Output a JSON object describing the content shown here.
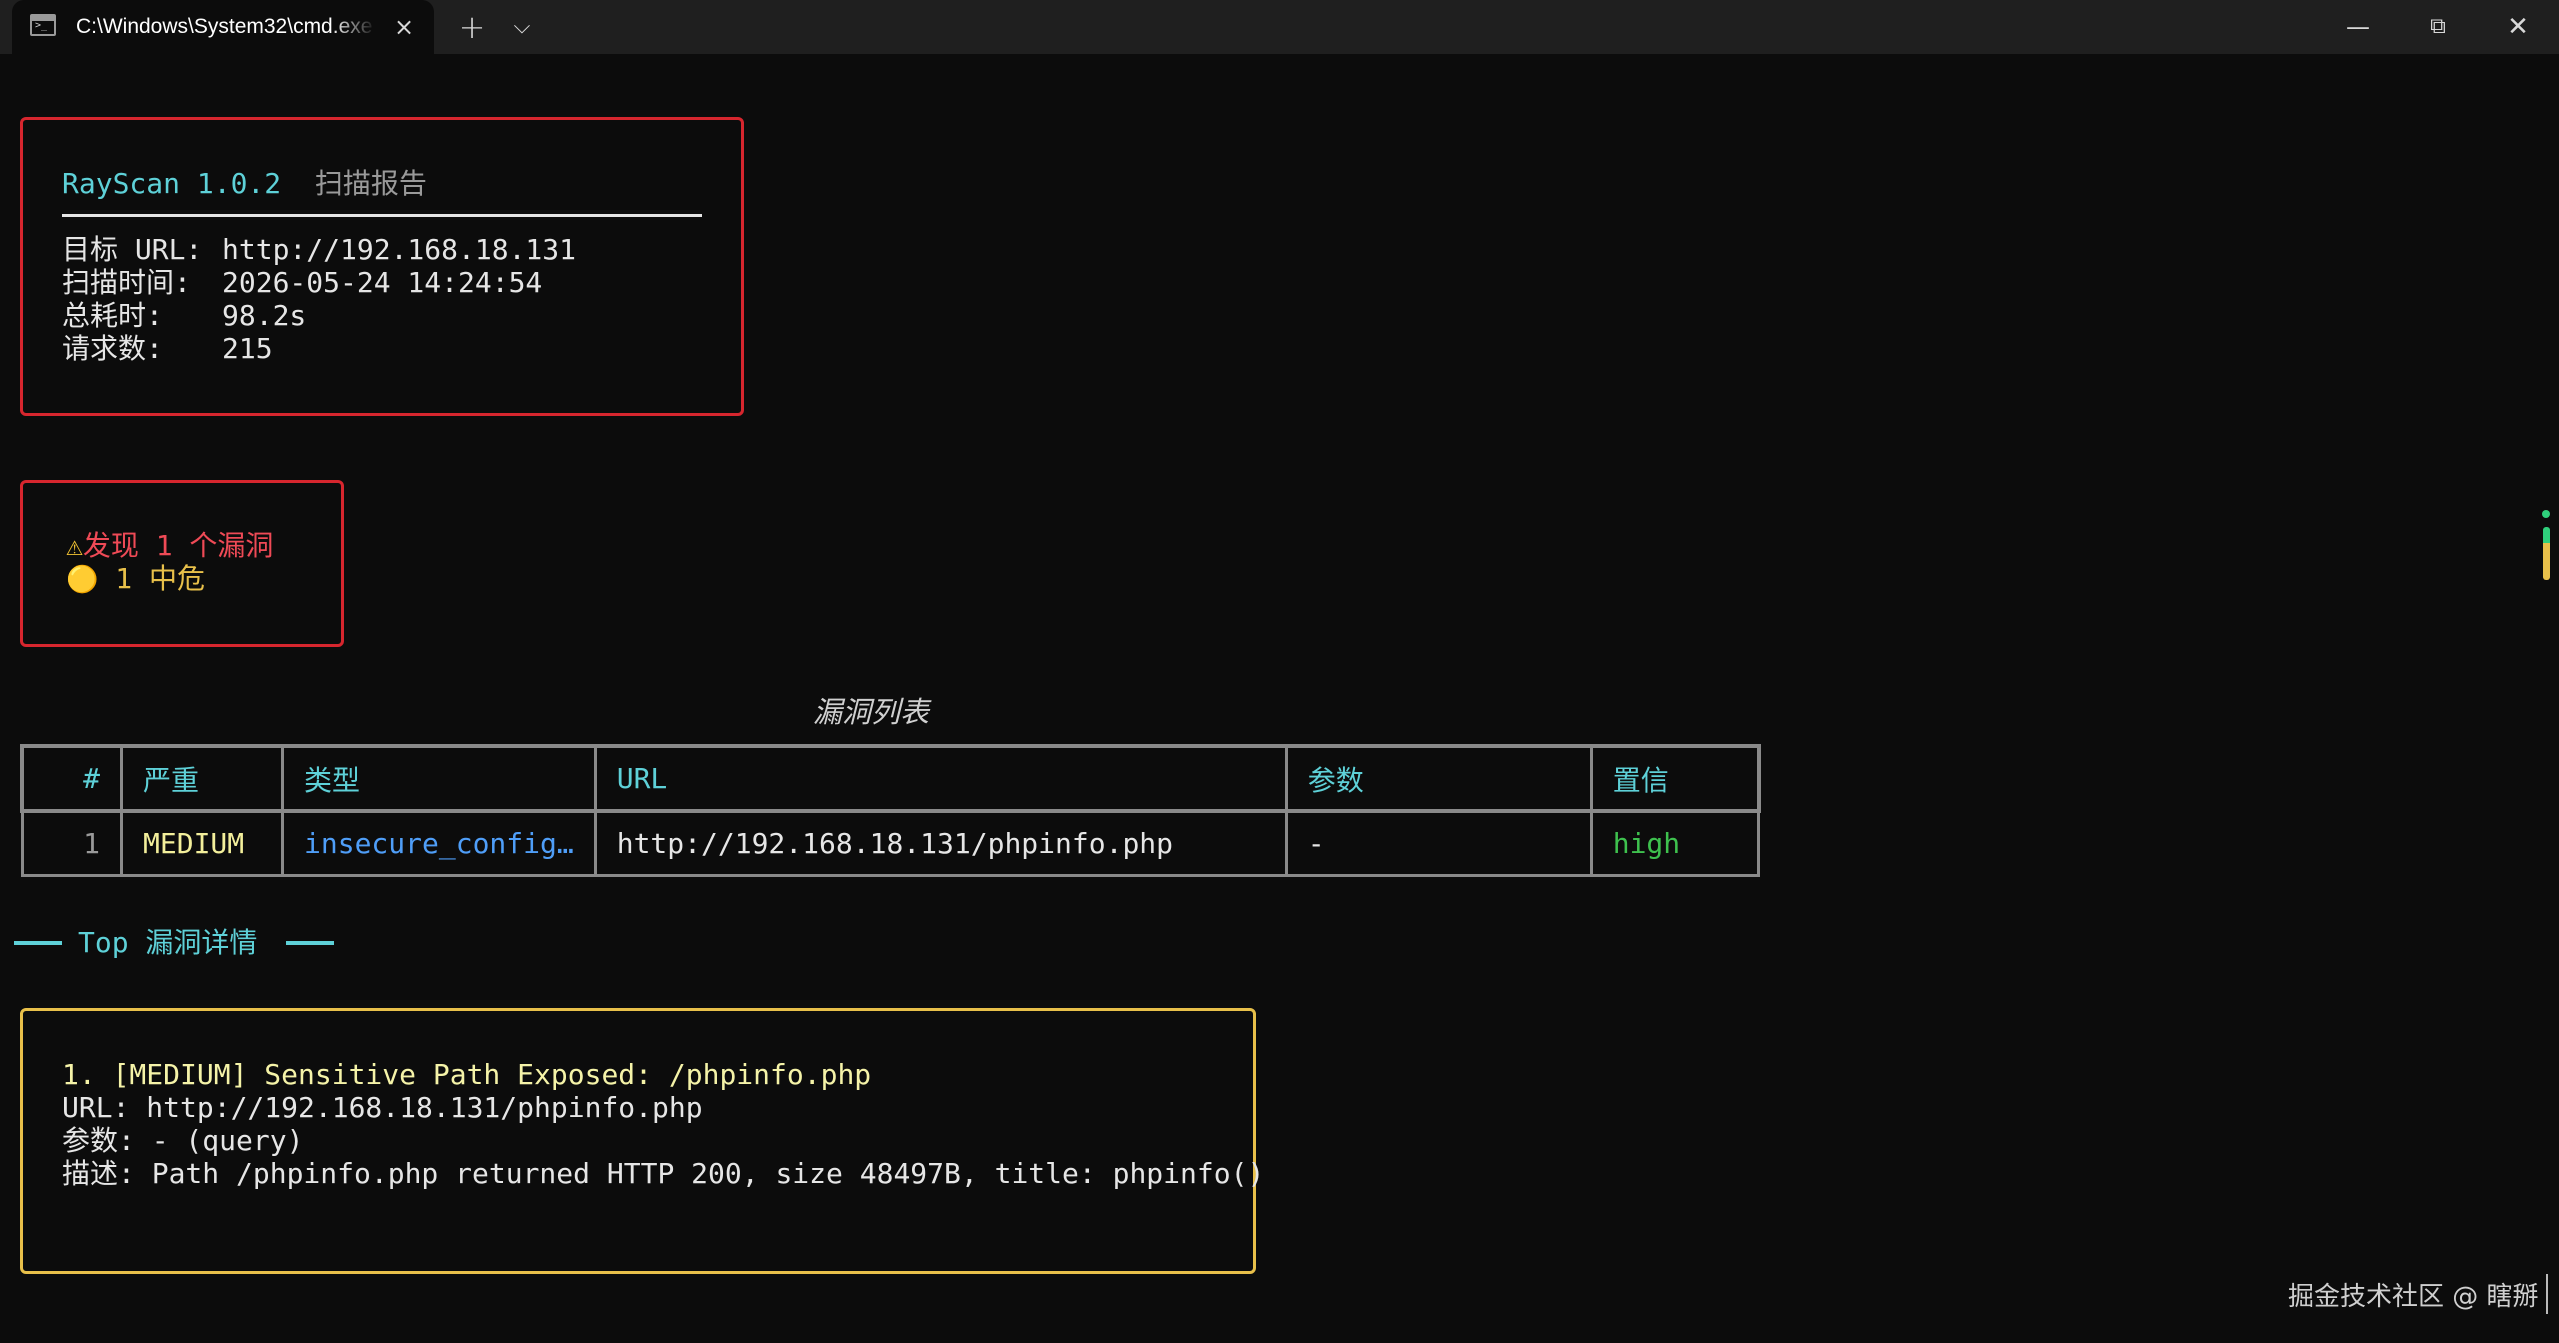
{
  "window": {
    "tab_title": "C:\\Windows\\System32\\cmd.exe",
    "tab_close": "×",
    "new_tab": "+",
    "tab_dropdown": "⌵",
    "minimize": "—",
    "maximize": "⧉",
    "close": "✕"
  },
  "report": {
    "app": "RayScan 1.0.2",
    "title": "扫描报告",
    "rows": [
      {
        "label": "目标 URL:",
        "value": "http://192.168.18.131"
      },
      {
        "label": "扫描时间:",
        "value": "2026-05-24 14:24:54"
      },
      {
        "label": "总耗时:",
        "value": "98.2s"
      },
      {
        "label": "请求数:",
        "value": "215"
      }
    ]
  },
  "summary": {
    "found_icon": "⚠",
    "found_text": "发现 1 个漏洞",
    "medium_icon": "🟡",
    "medium_text": "1 中危"
  },
  "vuln_table": {
    "caption": "漏洞列表",
    "headers": [
      "#",
      "严重",
      "类型",
      "URL",
      "参数",
      "置信"
    ],
    "rows": [
      {
        "num": "1",
        "severity": "MEDIUM",
        "type": "insecure_config…",
        "url": "http://192.168.18.131/phpinfo.php",
        "param": "-",
        "confidence": "high"
      }
    ]
  },
  "top_details": {
    "heading": "Top 漏洞详情",
    "items": [
      {
        "title": "1. [MEDIUM] Sensitive Path Exposed: /phpinfo.php",
        "url": "URL: http://192.168.18.131/phpinfo.php",
        "param": "参数: - (query)",
        "desc": "描述: Path /phpinfo.php returned HTTP 200, size 48497B, title: phpinfo()"
      }
    ]
  },
  "watermark": "掘金技术社区 @ 瞎掰",
  "colors": {
    "background": "#0c0c0c",
    "red_border": "#d7262e",
    "yellow_border": "#e8c04a",
    "cyan": "#5ed1d8",
    "type_blue": "#4f9ef8",
    "confidence_green": "#3ec14e"
  }
}
